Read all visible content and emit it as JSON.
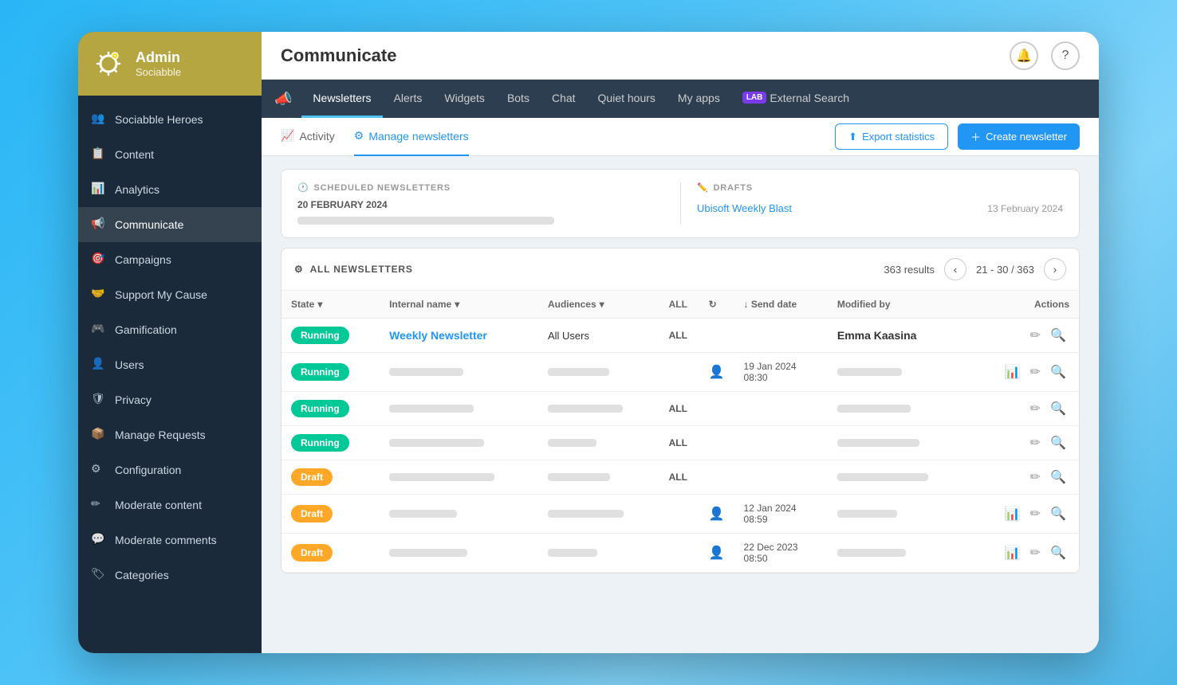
{
  "sidebar": {
    "admin_label": "Admin",
    "org_label": "Sociabble",
    "nav_items": [
      {
        "id": "sociabble-heroes",
        "label": "Sociabble Heroes",
        "active": false
      },
      {
        "id": "content",
        "label": "Content",
        "active": false
      },
      {
        "id": "analytics",
        "label": "Analytics",
        "active": false
      },
      {
        "id": "communicate",
        "label": "Communicate",
        "active": true
      },
      {
        "id": "campaigns",
        "label": "Campaigns",
        "active": false
      },
      {
        "id": "support-my-cause",
        "label": "Support My Cause",
        "active": false
      },
      {
        "id": "gamification",
        "label": "Gamification",
        "active": false
      },
      {
        "id": "users",
        "label": "Users",
        "active": false
      },
      {
        "id": "privacy",
        "label": "Privacy",
        "active": false
      },
      {
        "id": "manage-requests",
        "label": "Manage Requests",
        "active": false
      },
      {
        "id": "configuration",
        "label": "Configuration",
        "active": false
      },
      {
        "id": "moderate-content",
        "label": "Moderate content",
        "active": false
      },
      {
        "id": "moderate-comments",
        "label": "Moderate comments",
        "active": false
      },
      {
        "id": "categories",
        "label": "Categories",
        "active": false
      }
    ]
  },
  "header": {
    "page_title": "Communicate",
    "notification_icon": "🔔",
    "help_icon": "?"
  },
  "nav_tabs": [
    {
      "id": "newsletters",
      "label": "Newsletters",
      "active": true
    },
    {
      "id": "alerts",
      "label": "Alerts",
      "active": false
    },
    {
      "id": "widgets",
      "label": "Widgets",
      "active": false
    },
    {
      "id": "bots",
      "label": "Bots",
      "active": false
    },
    {
      "id": "chat",
      "label": "Chat",
      "active": false
    },
    {
      "id": "quiet-hours",
      "label": "Quiet hours",
      "active": false
    },
    {
      "id": "my-apps",
      "label": "My apps",
      "active": false
    },
    {
      "id": "external-search",
      "label": "External Search",
      "active": false,
      "badge": "LAB"
    }
  ],
  "sub_tabs": {
    "activity": {
      "label": "Activity",
      "active": false
    },
    "manage": {
      "label": "Manage newsletters",
      "active": true
    },
    "export_btn": "Export statistics",
    "create_btn": "Create newsletter"
  },
  "scheduled": {
    "section_title": "SCHEDULED NEWSLETTERS",
    "date": "20 FEBRUARY 2024",
    "placeholder_bar": true
  },
  "drafts": {
    "section_title": "DRAFTS",
    "items": [
      {
        "name": "Ubisoft Weekly Blast",
        "date": "13 February 2024"
      }
    ]
  },
  "all_newsletters": {
    "panel_title": "ALL NEWSLETTERS",
    "results_count": "363 results",
    "pagination": "21 - 30 / 363",
    "columns": {
      "state": "State",
      "internal_name": "Internal name",
      "audiences": "Audiences",
      "all_label": "ALL",
      "send_date": "↓ Send date",
      "modified_by": "Modified by",
      "actions": "Actions"
    },
    "rows": [
      {
        "state": "Running",
        "state_type": "running",
        "name": "Weekly Newsletter",
        "name_is_link": true,
        "audiences": "All Users",
        "audiences_tag": "ALL",
        "send_date": "",
        "modified_by": "Emma Kaasina",
        "has_stats": false
      },
      {
        "state": "Running",
        "state_type": "running",
        "name": "",
        "name_is_link": false,
        "audiences": "",
        "audiences_tag": "",
        "send_date": "19 Jan 2024\n08:30",
        "modified_by": "",
        "has_stats": true
      },
      {
        "state": "Running",
        "state_type": "running",
        "name": "",
        "name_is_link": false,
        "audiences": "",
        "audiences_tag": "ALL",
        "send_date": "",
        "modified_by": "",
        "has_stats": false
      },
      {
        "state": "Running",
        "state_type": "running",
        "name": "",
        "name_is_link": false,
        "audiences": "",
        "audiences_tag": "ALL",
        "send_date": "",
        "modified_by": "",
        "has_stats": false
      },
      {
        "state": "Draft",
        "state_type": "draft",
        "name": "",
        "name_is_link": false,
        "audiences": "",
        "audiences_tag": "ALL",
        "send_date": "",
        "modified_by": "",
        "has_stats": false
      },
      {
        "state": "Draft",
        "state_type": "draft",
        "name": "",
        "name_is_link": false,
        "audiences": "",
        "audiences_tag": "",
        "send_date": "12 Jan 2024\n08:59",
        "modified_by": "",
        "has_stats": true
      },
      {
        "state": "Draft",
        "state_type": "draft",
        "name": "",
        "name_is_link": false,
        "audiences": "",
        "audiences_tag": "",
        "send_date": "22 Dec 2023\n08:50",
        "modified_by": "",
        "has_stats": true
      }
    ]
  }
}
